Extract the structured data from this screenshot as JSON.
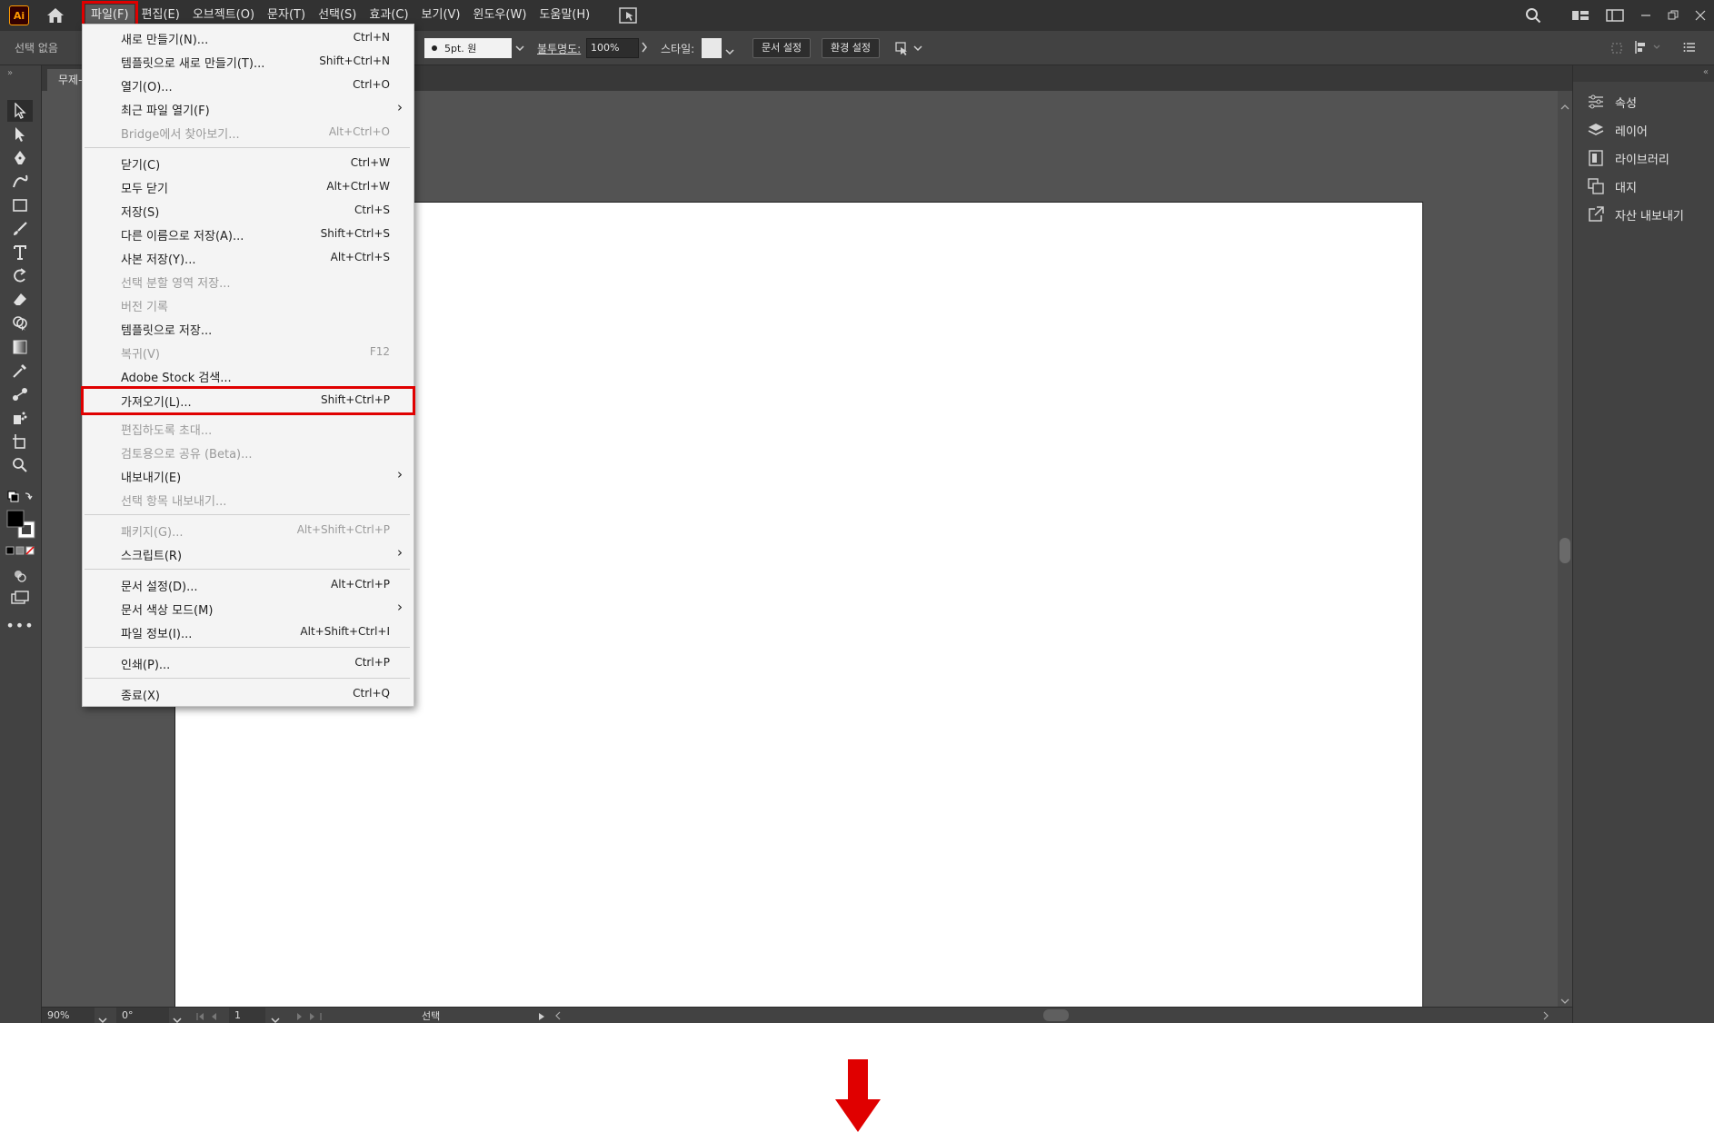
{
  "app": {
    "logo_text": "Ai",
    "menu": [
      "파일(F)",
      "편집(E)",
      "오브젝트(O)",
      "문자(T)",
      "선택(S)",
      "효과(C)",
      "보기(V)",
      "윈도우(W)",
      "도움말(H)"
    ],
    "active_menu": "파일(F)"
  },
  "controlbar": {
    "selection_label": "선택 없음",
    "stroke_value": "5pt. 원",
    "opacity_label": "불투명도:",
    "opacity_value": "100%",
    "style_label": "스타일:",
    "doc_setup_button": "문서 설정",
    "preferences_button": "환경 설정"
  },
  "document": {
    "tab_label": "무제-"
  },
  "statusbar": {
    "zoom": "90%",
    "rotation": "0°",
    "artboard_number": "1",
    "tool_status": "선택"
  },
  "right_panel": {
    "items": [
      {
        "label": "속성",
        "icon": "properties-icon"
      },
      {
        "label": "레이어",
        "icon": "layers-icon"
      },
      {
        "label": "라이브러리",
        "icon": "libraries-icon"
      },
      {
        "label": "대지",
        "icon": "artboards-icon"
      },
      {
        "label": "자산 내보내기",
        "icon": "export-assets-icon"
      }
    ]
  },
  "file_menu": {
    "items": [
      {
        "label": "새로 만들기(N)...",
        "shortcut": "Ctrl+N",
        "enabled": true
      },
      {
        "label": "템플릿으로 새로 만들기(T)...",
        "shortcut": "Shift+Ctrl+N",
        "enabled": true
      },
      {
        "label": "열기(O)...",
        "shortcut": "Ctrl+O",
        "enabled": true
      },
      {
        "label": "최근 파일 열기(F)",
        "shortcut": "",
        "enabled": true,
        "submenu": true
      },
      {
        "label": "Bridge에서 찾아보기...",
        "shortcut": "Alt+Ctrl+O",
        "enabled": false
      },
      {
        "label": "닫기(C)",
        "shortcut": "Ctrl+W",
        "enabled": true
      },
      {
        "label": "모두 닫기",
        "shortcut": "Alt+Ctrl+W",
        "enabled": true
      },
      {
        "label": "저장(S)",
        "shortcut": "Ctrl+S",
        "enabled": true
      },
      {
        "label": "다른 이름으로 저장(A)...",
        "shortcut": "Shift+Ctrl+S",
        "enabled": true
      },
      {
        "label": "사본 저장(Y)...",
        "shortcut": "Alt+Ctrl+S",
        "enabled": true
      },
      {
        "label": "선택 분할 영역 저장...",
        "shortcut": "",
        "enabled": false
      },
      {
        "label": "버전 기록",
        "shortcut": "",
        "enabled": false
      },
      {
        "label": "템플릿으로 저장...",
        "shortcut": "",
        "enabled": true
      },
      {
        "label": "복귀(V)",
        "shortcut": "F12",
        "enabled": false
      },
      {
        "label": "Adobe Stock 검색...",
        "shortcut": "",
        "enabled": true
      },
      {
        "label": "가져오기(L)...",
        "shortcut": "Shift+Ctrl+P",
        "enabled": true,
        "highlighted": true
      },
      {
        "label": "편집하도록 초대...",
        "shortcut": "",
        "enabled": false
      },
      {
        "label": "검토용으로 공유 (Beta)...",
        "shortcut": "",
        "enabled": false
      },
      {
        "label": "내보내기(E)",
        "shortcut": "",
        "enabled": true,
        "submenu": true
      },
      {
        "label": "선택 항목 내보내기...",
        "shortcut": "",
        "enabled": false
      },
      {
        "label": "패키지(G)...",
        "shortcut": "Alt+Shift+Ctrl+P",
        "enabled": false
      },
      {
        "label": "스크립트(R)",
        "shortcut": "",
        "enabled": true,
        "submenu": true
      },
      {
        "label": "문서 설정(D)...",
        "shortcut": "Alt+Ctrl+P",
        "enabled": true
      },
      {
        "label": "문서 색상 모드(M)",
        "shortcut": "",
        "enabled": true,
        "submenu": true
      },
      {
        "label": "파일 정보(I)...",
        "shortcut": "Alt+Shift+Ctrl+I",
        "enabled": true
      },
      {
        "label": "인쇄(P)...",
        "shortcut": "Ctrl+P",
        "enabled": true
      },
      {
        "label": "종료(X)",
        "shortcut": "Ctrl+Q",
        "enabled": true
      }
    ]
  },
  "colors": {
    "highlight": "#e00000",
    "ui_dark": "#323232",
    "ui_panel": "#424242",
    "canvas_bg": "#535353",
    "menu_bg": "#f4f4f4"
  }
}
